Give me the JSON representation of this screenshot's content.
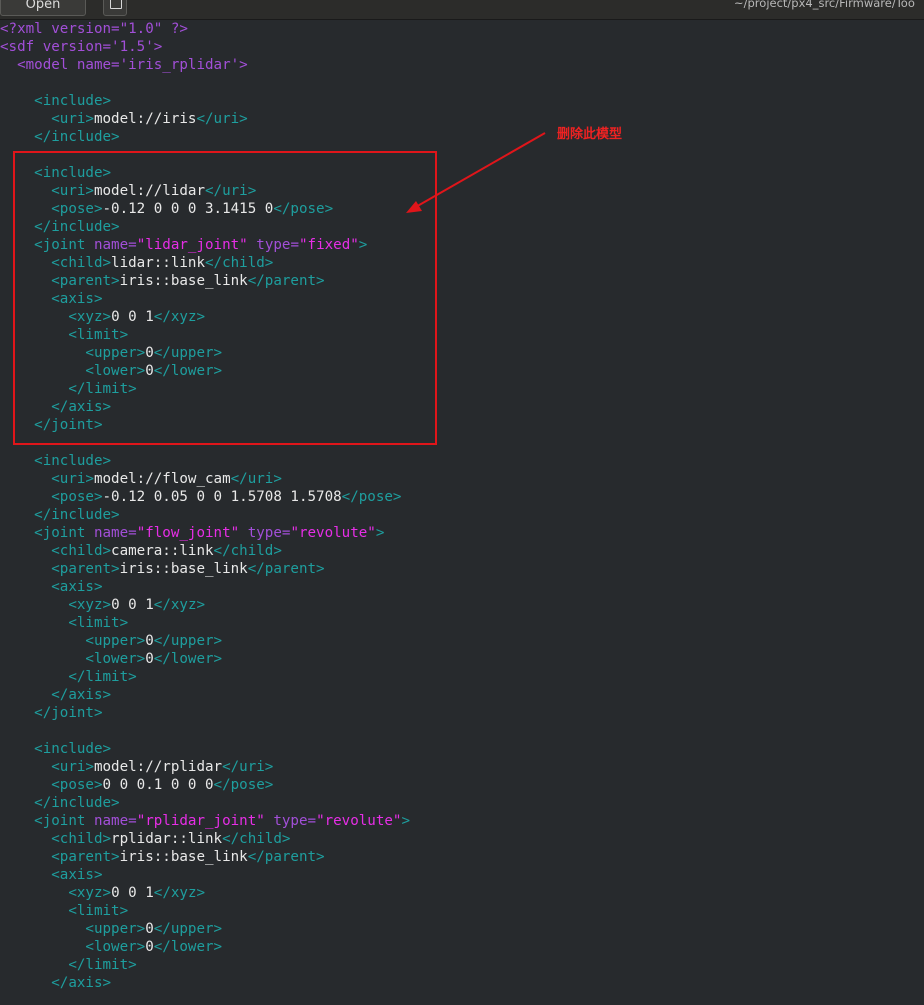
{
  "toolbar": {
    "open_label": "Open",
    "file_path": "~/project/px4_src/Firmware/Too"
  },
  "annotation": {
    "text": "删除此模型"
  },
  "colors": {
    "tag": "#1e9e9e",
    "content": "#e8e8e8",
    "attribute": "#a24fd8",
    "attribute_value": "#e62ee6",
    "highlight": "#e0151a"
  },
  "editor_lines": [
    [
      {
        "t": "a",
        "s": "<?xml version=\"1.0\" ?>"
      }
    ],
    [
      {
        "t": "a",
        "s": "<sdf version='1.5'>"
      }
    ],
    [
      {
        "t": "c",
        "s": "  "
      },
      {
        "t": "a",
        "s": "<model name='iris_rplidar'>"
      }
    ],
    [],
    [
      {
        "t": "c",
        "s": "    "
      },
      {
        "t": "t",
        "s": "<include>"
      }
    ],
    [
      {
        "t": "c",
        "s": "      "
      },
      {
        "t": "t",
        "s": "<uri>"
      },
      {
        "t": "c",
        "s": "model://iris"
      },
      {
        "t": "t",
        "s": "</uri>"
      }
    ],
    [
      {
        "t": "c",
        "s": "    "
      },
      {
        "t": "t",
        "s": "</include>"
      }
    ],
    [],
    [
      {
        "t": "c",
        "s": "    "
      },
      {
        "t": "t",
        "s": "<include>"
      }
    ],
    [
      {
        "t": "c",
        "s": "      "
      },
      {
        "t": "t",
        "s": "<uri>"
      },
      {
        "t": "c",
        "s": "model://lidar"
      },
      {
        "t": "t",
        "s": "</uri>"
      }
    ],
    [
      {
        "t": "c",
        "s": "      "
      },
      {
        "t": "t",
        "s": "<pose>"
      },
      {
        "t": "c",
        "s": "-0.12 0 0 0 3.1415 0"
      },
      {
        "t": "t",
        "s": "</pose>"
      }
    ],
    [
      {
        "t": "c",
        "s": "    "
      },
      {
        "t": "t",
        "s": "</include>"
      }
    ],
    [
      {
        "t": "c",
        "s": "    "
      },
      {
        "t": "t",
        "s": "<joint "
      },
      {
        "t": "a",
        "s": "name="
      },
      {
        "t": "v",
        "s": "\"lidar_joint\""
      },
      {
        "t": "a",
        "s": " type="
      },
      {
        "t": "v",
        "s": "\"fixed\""
      },
      {
        "t": "t",
        "s": ">"
      }
    ],
    [
      {
        "t": "c",
        "s": "      "
      },
      {
        "t": "t",
        "s": "<child>"
      },
      {
        "t": "c",
        "s": "lidar::link"
      },
      {
        "t": "t",
        "s": "</child>"
      }
    ],
    [
      {
        "t": "c",
        "s": "      "
      },
      {
        "t": "t",
        "s": "<parent>"
      },
      {
        "t": "c",
        "s": "iris::base_link"
      },
      {
        "t": "t",
        "s": "</parent>"
      }
    ],
    [
      {
        "t": "c",
        "s": "      "
      },
      {
        "t": "t",
        "s": "<axis>"
      }
    ],
    [
      {
        "t": "c",
        "s": "        "
      },
      {
        "t": "t",
        "s": "<xyz>"
      },
      {
        "t": "c",
        "s": "0 0 1"
      },
      {
        "t": "t",
        "s": "</xyz>"
      }
    ],
    [
      {
        "t": "c",
        "s": "        "
      },
      {
        "t": "t",
        "s": "<limit>"
      }
    ],
    [
      {
        "t": "c",
        "s": "          "
      },
      {
        "t": "t",
        "s": "<upper>"
      },
      {
        "t": "c",
        "s": "0"
      },
      {
        "t": "t",
        "s": "</upper>"
      }
    ],
    [
      {
        "t": "c",
        "s": "          "
      },
      {
        "t": "t",
        "s": "<lower>"
      },
      {
        "t": "c",
        "s": "0"
      },
      {
        "t": "t",
        "s": "</lower>"
      }
    ],
    [
      {
        "t": "c",
        "s": "        "
      },
      {
        "t": "t",
        "s": "</limit>"
      }
    ],
    [
      {
        "t": "c",
        "s": "      "
      },
      {
        "t": "t",
        "s": "</axis>"
      }
    ],
    [
      {
        "t": "c",
        "s": "    "
      },
      {
        "t": "t",
        "s": "</joint>"
      }
    ],
    [],
    [
      {
        "t": "c",
        "s": "    "
      },
      {
        "t": "t",
        "s": "<include>"
      }
    ],
    [
      {
        "t": "c",
        "s": "      "
      },
      {
        "t": "t",
        "s": "<uri>"
      },
      {
        "t": "c",
        "s": "model://flow_cam"
      },
      {
        "t": "t",
        "s": "</uri>"
      }
    ],
    [
      {
        "t": "c",
        "s": "      "
      },
      {
        "t": "t",
        "s": "<pose>"
      },
      {
        "t": "c",
        "s": "-0.12 0.05 0 0 1.5708 1.5708"
      },
      {
        "t": "t",
        "s": "</pose>"
      }
    ],
    [
      {
        "t": "c",
        "s": "    "
      },
      {
        "t": "t",
        "s": "</include>"
      }
    ],
    [
      {
        "t": "c",
        "s": "    "
      },
      {
        "t": "t",
        "s": "<joint "
      },
      {
        "t": "a",
        "s": "name="
      },
      {
        "t": "v",
        "s": "\"flow_joint\""
      },
      {
        "t": "a",
        "s": " type="
      },
      {
        "t": "v",
        "s": "\"revolute\""
      },
      {
        "t": "t",
        "s": ">"
      }
    ],
    [
      {
        "t": "c",
        "s": "      "
      },
      {
        "t": "t",
        "s": "<child>"
      },
      {
        "t": "c",
        "s": "camera::link"
      },
      {
        "t": "t",
        "s": "</child>"
      }
    ],
    [
      {
        "t": "c",
        "s": "      "
      },
      {
        "t": "t",
        "s": "<parent>"
      },
      {
        "t": "c",
        "s": "iris::base_link"
      },
      {
        "t": "t",
        "s": "</parent>"
      }
    ],
    [
      {
        "t": "c",
        "s": "      "
      },
      {
        "t": "t",
        "s": "<axis>"
      }
    ],
    [
      {
        "t": "c",
        "s": "        "
      },
      {
        "t": "t",
        "s": "<xyz>"
      },
      {
        "t": "c",
        "s": "0 0 1"
      },
      {
        "t": "t",
        "s": "</xyz>"
      }
    ],
    [
      {
        "t": "c",
        "s": "        "
      },
      {
        "t": "t",
        "s": "<limit>"
      }
    ],
    [
      {
        "t": "c",
        "s": "          "
      },
      {
        "t": "t",
        "s": "<upper>"
      },
      {
        "t": "c",
        "s": "0"
      },
      {
        "t": "t",
        "s": "</upper>"
      }
    ],
    [
      {
        "t": "c",
        "s": "          "
      },
      {
        "t": "t",
        "s": "<lower>"
      },
      {
        "t": "c",
        "s": "0"
      },
      {
        "t": "t",
        "s": "</lower>"
      }
    ],
    [
      {
        "t": "c",
        "s": "        "
      },
      {
        "t": "t",
        "s": "</limit>"
      }
    ],
    [
      {
        "t": "c",
        "s": "      "
      },
      {
        "t": "t",
        "s": "</axis>"
      }
    ],
    [
      {
        "t": "c",
        "s": "    "
      },
      {
        "t": "t",
        "s": "</joint>"
      }
    ],
    [],
    [
      {
        "t": "c",
        "s": "    "
      },
      {
        "t": "t",
        "s": "<include>"
      }
    ],
    [
      {
        "t": "c",
        "s": "      "
      },
      {
        "t": "t",
        "s": "<uri>"
      },
      {
        "t": "c",
        "s": "model://rplidar"
      },
      {
        "t": "t",
        "s": "</uri>"
      }
    ],
    [
      {
        "t": "c",
        "s": "      "
      },
      {
        "t": "t",
        "s": "<pose>"
      },
      {
        "t": "c",
        "s": "0 0 0.1 0 0 0"
      },
      {
        "t": "t",
        "s": "</pose>"
      }
    ],
    [
      {
        "t": "c",
        "s": "    "
      },
      {
        "t": "t",
        "s": "</include>"
      }
    ],
    [
      {
        "t": "c",
        "s": "    "
      },
      {
        "t": "t",
        "s": "<joint "
      },
      {
        "t": "a",
        "s": "name="
      },
      {
        "t": "v",
        "s": "\"rplidar_joint\""
      },
      {
        "t": "a",
        "s": " type="
      },
      {
        "t": "v",
        "s": "\"revolute\""
      },
      {
        "t": "t",
        "s": ">"
      }
    ],
    [
      {
        "t": "c",
        "s": "      "
      },
      {
        "t": "t",
        "s": "<child>"
      },
      {
        "t": "c",
        "s": "rplidar::link"
      },
      {
        "t": "t",
        "s": "</child>"
      }
    ],
    [
      {
        "t": "c",
        "s": "      "
      },
      {
        "t": "t",
        "s": "<parent>"
      },
      {
        "t": "c",
        "s": "iris::base_link"
      },
      {
        "t": "t",
        "s": "</parent>"
      }
    ],
    [
      {
        "t": "c",
        "s": "      "
      },
      {
        "t": "t",
        "s": "<axis>"
      }
    ],
    [
      {
        "t": "c",
        "s": "        "
      },
      {
        "t": "t",
        "s": "<xyz>"
      },
      {
        "t": "c",
        "s": "0 0 1"
      },
      {
        "t": "t",
        "s": "</xyz>"
      }
    ],
    [
      {
        "t": "c",
        "s": "        "
      },
      {
        "t": "t",
        "s": "<limit>"
      }
    ],
    [
      {
        "t": "c",
        "s": "          "
      },
      {
        "t": "t",
        "s": "<upper>"
      },
      {
        "t": "c",
        "s": "0"
      },
      {
        "t": "t",
        "s": "</upper>"
      }
    ],
    [
      {
        "t": "c",
        "s": "          "
      },
      {
        "t": "t",
        "s": "<lower>"
      },
      {
        "t": "c",
        "s": "0"
      },
      {
        "t": "t",
        "s": "</lower>"
      }
    ],
    [
      {
        "t": "c",
        "s": "        "
      },
      {
        "t": "t",
        "s": "</limit>"
      }
    ],
    [
      {
        "t": "c",
        "s": "      "
      },
      {
        "t": "t",
        "s": "</axis>"
      }
    ]
  ]
}
